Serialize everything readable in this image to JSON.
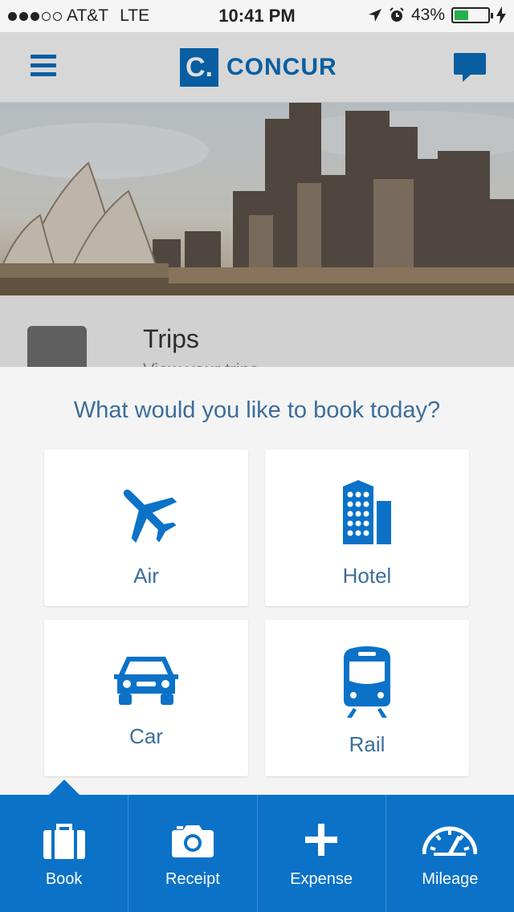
{
  "status_bar": {
    "carrier": "AT&T",
    "network": "LTE",
    "time": "10:41 PM",
    "battery": "43%",
    "battery_level": 0.43,
    "signal_bars": 3
  },
  "header": {
    "logo_mark": "C.",
    "logo_text": "CONCUR"
  },
  "background_item": {
    "title": "Trips",
    "subtitle": "View your trips"
  },
  "booking_sheet": {
    "title": "What would you like to book today?",
    "options": [
      {
        "label": "Air",
        "icon": "airplane-icon"
      },
      {
        "label": "Hotel",
        "icon": "hotel-icon"
      },
      {
        "label": "Car",
        "icon": "car-icon"
      },
      {
        "label": "Rail",
        "icon": "train-icon"
      }
    ]
  },
  "tabbar": {
    "tabs": [
      {
        "label": "Book",
        "icon": "suitcase-icon",
        "selected": true
      },
      {
        "label": "Receipt",
        "icon": "camera-icon"
      },
      {
        "label": "Expense",
        "icon": "plus-icon"
      },
      {
        "label": "Mileage",
        "icon": "speedometer-icon"
      }
    ]
  },
  "colors": {
    "brand_blue": "#0b6cb8",
    "tab_blue": "#0b72c8",
    "label_blue": "#3c6e9a"
  }
}
